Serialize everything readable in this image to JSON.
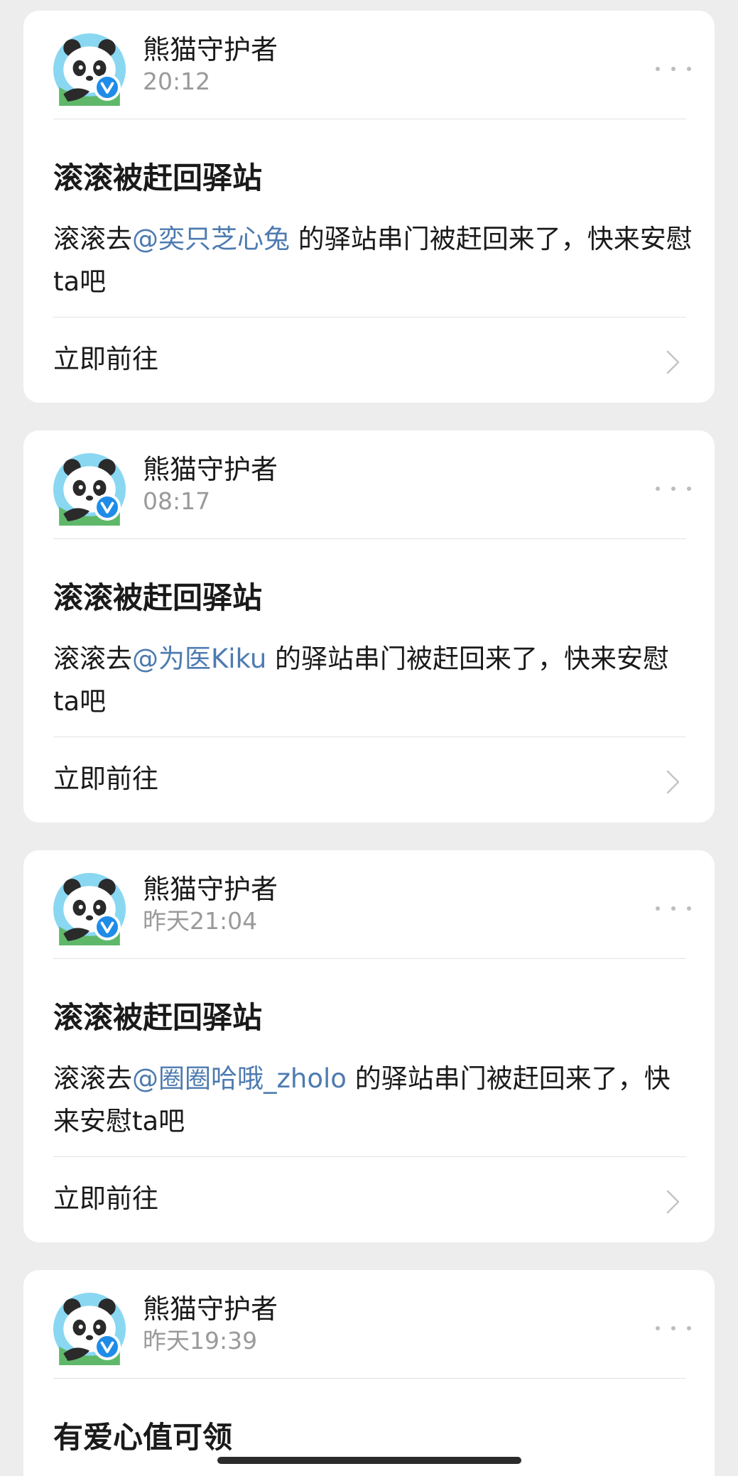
{
  "colors": {
    "background": "#ededed",
    "card": "#ffffff",
    "mention": "#4e7bb0",
    "timestamp": "#9a9a9a",
    "verified_badge": "#1f8ce8",
    "avatar_sky": "#8ad7f2"
  },
  "icons": {
    "avatar": "panda-avatar-icon",
    "verified": "verified-v-badge-icon",
    "more": "more-dots-icon",
    "chevron": "chevron-right-icon"
  },
  "messages": [
    {
      "sender": "熊猫守护者",
      "time": "20:12",
      "title": "滚滚被赶回驿站",
      "body_prefix": "滚滚去",
      "mention": "@奕只芝心兔",
      "body_suffix": " 的驿站串门被赶回来了，快来安慰ta吧",
      "action": "立即前往"
    },
    {
      "sender": "熊猫守护者",
      "time": "08:17",
      "title": "滚滚被赶回驿站",
      "body_prefix": "滚滚去",
      "mention": "@为医Kiku",
      "body_suffix": " 的驿站串门被赶回来了，快来安慰ta吧",
      "action": "立即前往"
    },
    {
      "sender": "熊猫守护者",
      "time": "昨天21:04",
      "title": "滚滚被赶回驿站",
      "body_prefix": "滚滚去",
      "mention": "@圈圈哈哦_zholo",
      "body_suffix": " 的驿站串门被赶回来了，快来安慰ta吧",
      "action": "立即前往"
    },
    {
      "sender": "熊猫守护者",
      "time": "昨天19:39",
      "title": "有爱心值可领"
    }
  ]
}
